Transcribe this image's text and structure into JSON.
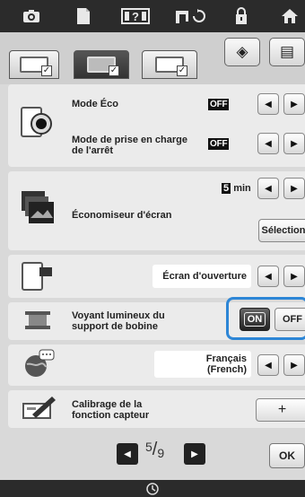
{
  "top_icons": [
    "camera-icon",
    "document-icon",
    "help-icon",
    "sewing-machine-icon",
    "lock-icon",
    "home-icon"
  ],
  "top_icon_glyphs": [
    "◘",
    "▮",
    "⍰",
    "✂",
    "🔒",
    "⌂"
  ],
  "help_glyph": "?",
  "tabs": [
    {
      "name": "general-settings-tab",
      "check": "✓"
    },
    {
      "name": "embroidery-settings-tab",
      "check": "✓"
    },
    {
      "name": "machine-settings-tab",
      "check": "✓"
    }
  ],
  "top_buttons": {
    "reset_glyph": "◈",
    "machine_glyph": "▤"
  },
  "settings": {
    "eco_mode": {
      "label": "Mode Éco",
      "value": "OFF"
    },
    "shutdown_support": {
      "label_line1": "Mode de prise en charge",
      "label_line2": "de l'arrêt",
      "value": "OFF"
    },
    "screensaver": {
      "label": "Économiseur d'écran",
      "value_num": "5",
      "value_unit": "min",
      "select_label": "Sélection"
    },
    "opening_screen": {
      "label": "Écran d'ouverture"
    },
    "bobbin_light": {
      "label_line1": "Voyant lumineux du",
      "label_line2": "support de bobine",
      "on_label": "ON",
      "off_label": "OFF"
    },
    "language": {
      "value_line1": "Français",
      "value_line2": "(French)"
    },
    "sensor_calibration": {
      "label_line1": "Calibrage de la",
      "label_line2": "fonction capteur",
      "button_label": "+"
    }
  },
  "arrows": {
    "left": "◀",
    "right": "▶"
  },
  "pager": {
    "current": "5",
    "separator": "/",
    "total": "9"
  },
  "ok_label": "OK",
  "bottom_icon": "⊙",
  "colors": {
    "highlight": "#2d86d6",
    "topbar": "#2b2b2b"
  }
}
